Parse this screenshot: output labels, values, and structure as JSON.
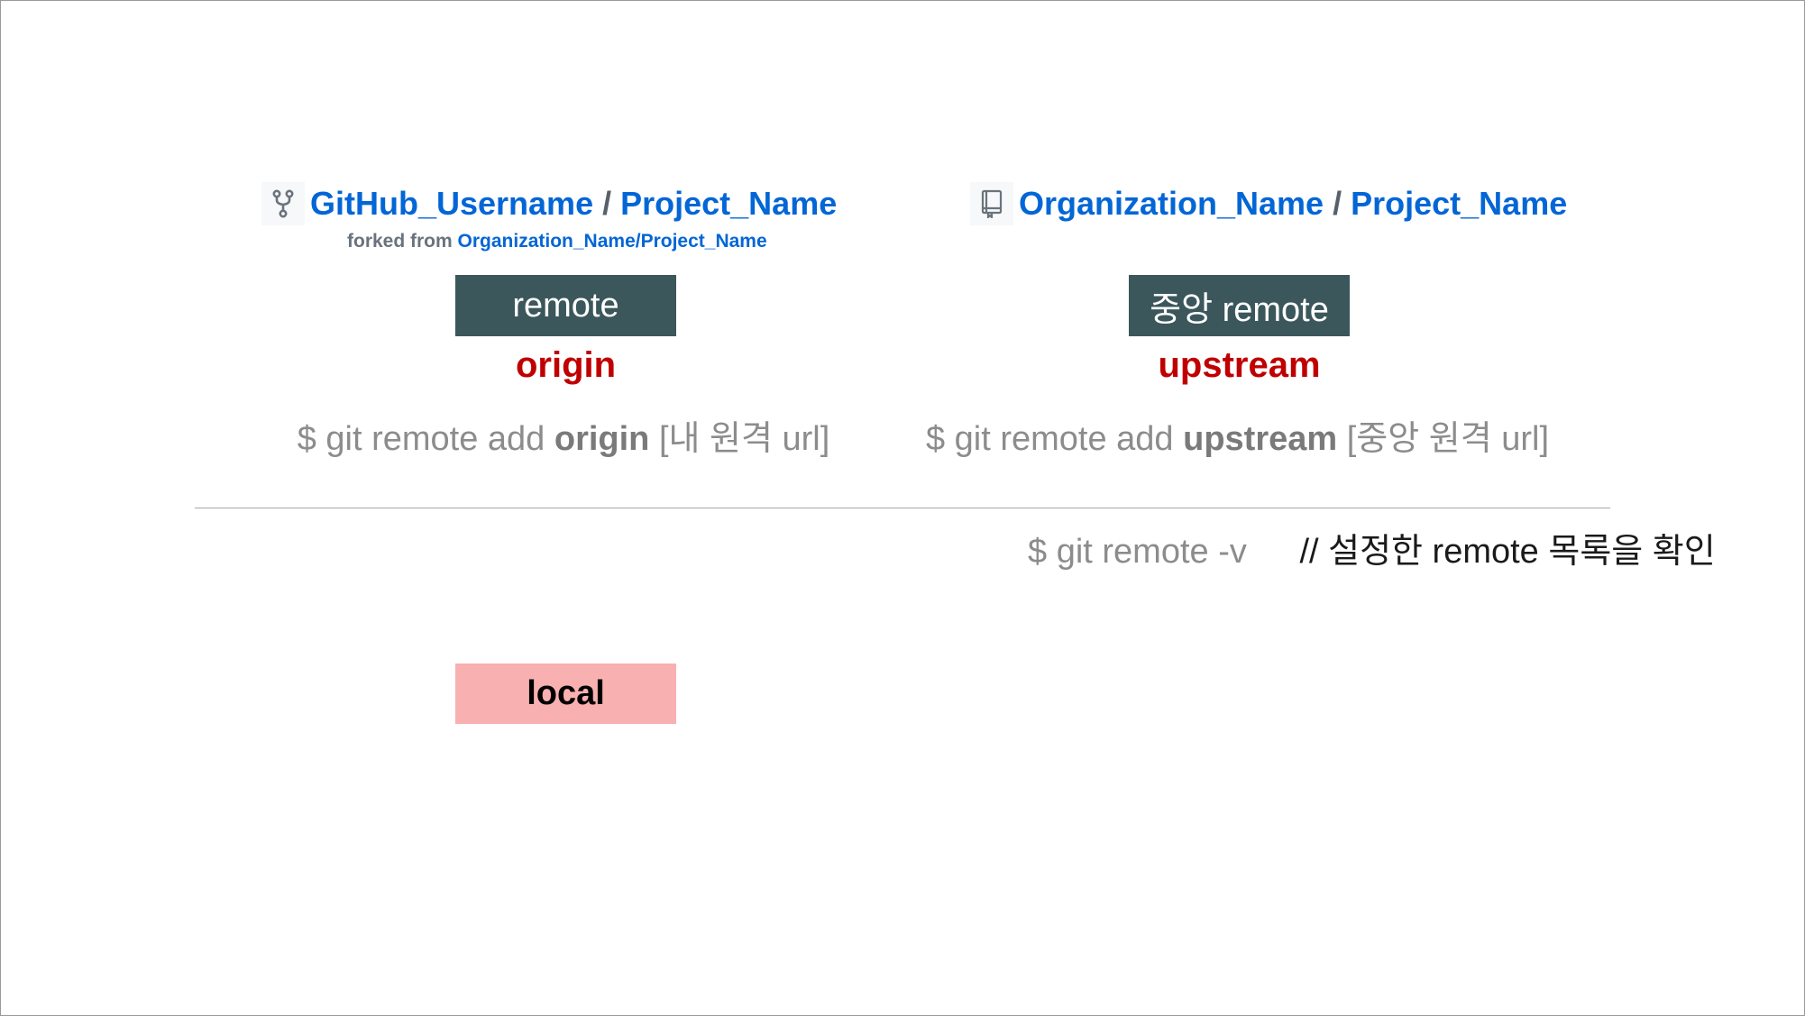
{
  "fork_repo": {
    "icon": "repo-forked-icon",
    "owner": "GitHub_Username",
    "separator": "/",
    "name": "Project_Name",
    "forked_from_label": "forked from",
    "forked_from_link": "Organization_Name/Project_Name"
  },
  "upstream_repo": {
    "icon": "repo-book-icon",
    "owner": "Organization_Name",
    "separator": "/",
    "name": "Project_Name"
  },
  "left": {
    "box_label": "remote",
    "remote_name": "origin",
    "command_prefix": "$ git remote add",
    "command_arg": "origin",
    "command_suffix": "[내 원격 url]"
  },
  "right": {
    "box_label": "중앙 remote",
    "remote_name": "upstream",
    "command_prefix": "$ git remote add",
    "command_arg": "upstream",
    "command_suffix": "[중앙 원격 url]"
  },
  "verify": {
    "command": "$ git remote -v",
    "comment": "// 설정한 remote 목록을 확인"
  },
  "local_box": {
    "label": "local"
  },
  "colors": {
    "link_blue": "#0366d6",
    "remote_box": "#3b575b",
    "remote_name_red": "#c00000",
    "local_box": "#f9b0b0",
    "command_gray": "#8c8c8c"
  }
}
